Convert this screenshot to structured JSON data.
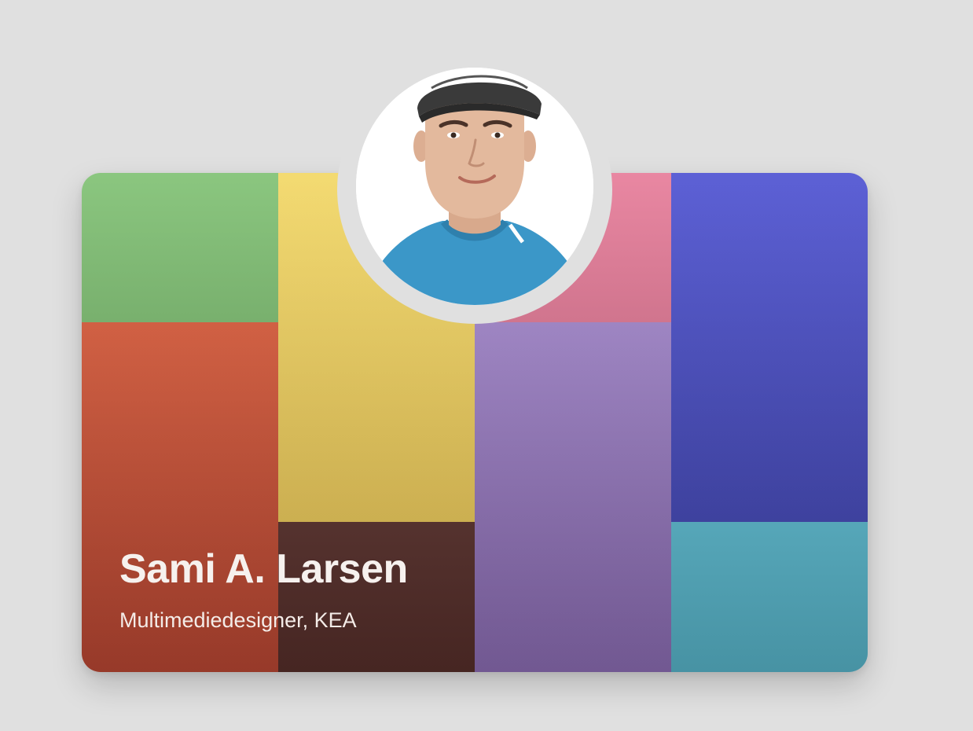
{
  "profile": {
    "name": "Sami A. Larsen",
    "role": "Multimediedesigner, KEA"
  },
  "palette": {
    "background": "#e0e0e0",
    "green": "#86c47a",
    "red": "#c8553a",
    "yellow": "#f0d26a",
    "brown": "#4e2a26",
    "pink": "#e8829e",
    "purple": "#9077b6",
    "blue": "#5358cc",
    "teal": "#4fa3b6"
  },
  "avatar": {
    "icon": "person-portrait-icon",
    "cap_color": "#3a3a3a",
    "shirt_color": "#3b97c8",
    "skin_color": "#e3b99d"
  }
}
